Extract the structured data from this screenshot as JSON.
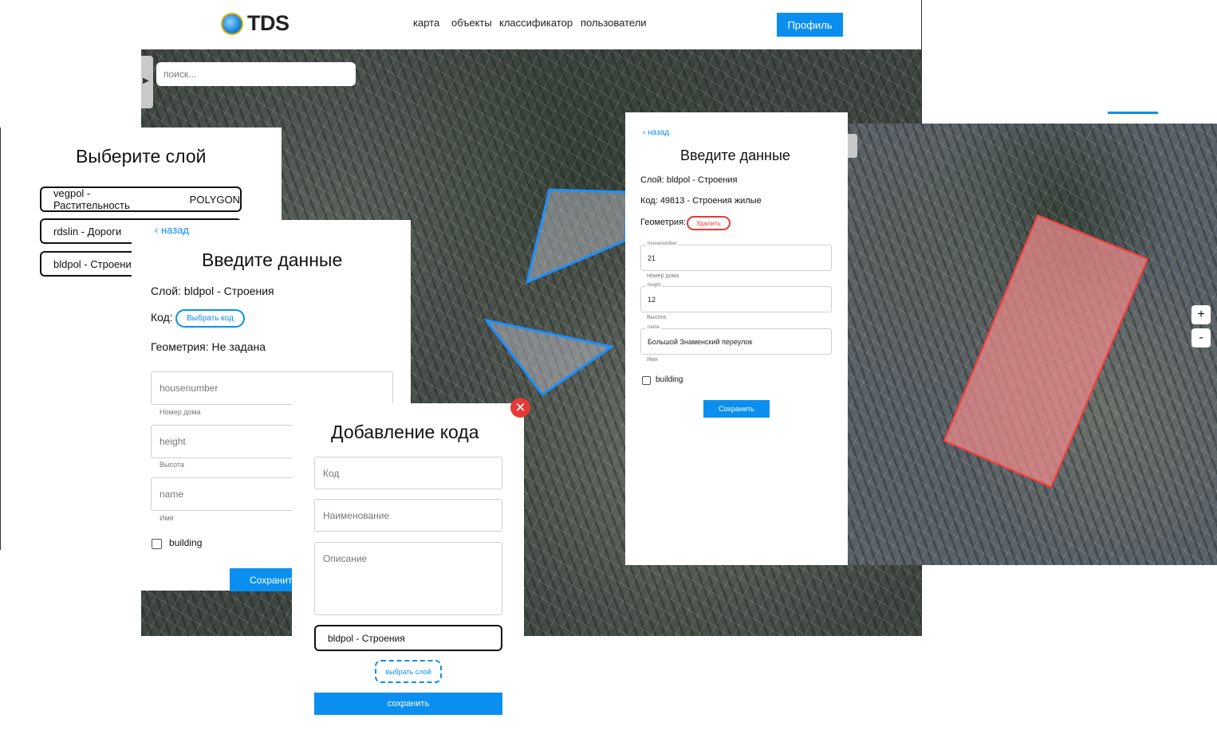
{
  "app": {
    "logo_text": "TDS",
    "nav": [
      "карта",
      "объекты",
      "классификатор",
      "пользователи"
    ],
    "profile_label": "Профиль",
    "search_placeholder": "поиск..."
  },
  "layer_select": {
    "title": "Выберите слой",
    "layers": [
      {
        "label": "vegpol - Растительность",
        "type": "POLYGON"
      },
      {
        "label": "rdslin - Дороги",
        "type": ""
      },
      {
        "label": "bldpol - Строения",
        "type": ""
      }
    ]
  },
  "data_form": {
    "back": "назад",
    "title": "Введите данные",
    "layer_label": "Слой: bldpol - Строения",
    "code_label": "Код:",
    "code_button": "Выбрать код",
    "geometry_label": "Геометрия: Не задана",
    "fields": [
      {
        "placeholder": "housenumber",
        "hint": "Номер дома"
      },
      {
        "placeholder": "height",
        "hint": "Высота"
      },
      {
        "placeholder": "name",
        "hint": "Имя"
      }
    ],
    "checkbox_label": "building",
    "save_label": "Сохранить"
  },
  "add_code_modal": {
    "title": "Добавление кода",
    "code_placeholder": "Код",
    "name_placeholder": "Наименование",
    "description_placeholder": "Описание",
    "layer_value": "bldpol - Строения",
    "pick_layer_label": "выбрать слой",
    "save_label": "сохранить",
    "close_icon": "✕"
  },
  "data_form_filled": {
    "back": "назад",
    "title": "Введите данные",
    "layer_label": "Слой: bldpol - Строения",
    "code_label": "Код: 49813 - Строения жилые",
    "geometry_label": "Геометрия:",
    "delete_label": "Удалить",
    "fields": [
      {
        "label": "housenumber",
        "value": "21",
        "hint": "Номер дома"
      },
      {
        "label": "height",
        "value": "12",
        "hint": "Высота"
      },
      {
        "label": "name",
        "value": "Большой Знаменский переулок",
        "hint": "Имя"
      }
    ],
    "checkbox_label": "building",
    "save_label": "Сохранить"
  },
  "map_controls": {
    "zoom_in": "+",
    "zoom_out": "-"
  },
  "colors": {
    "accent": "#0a8ff0",
    "danger": "#e53935",
    "selection_fill": "#f08a8a"
  }
}
